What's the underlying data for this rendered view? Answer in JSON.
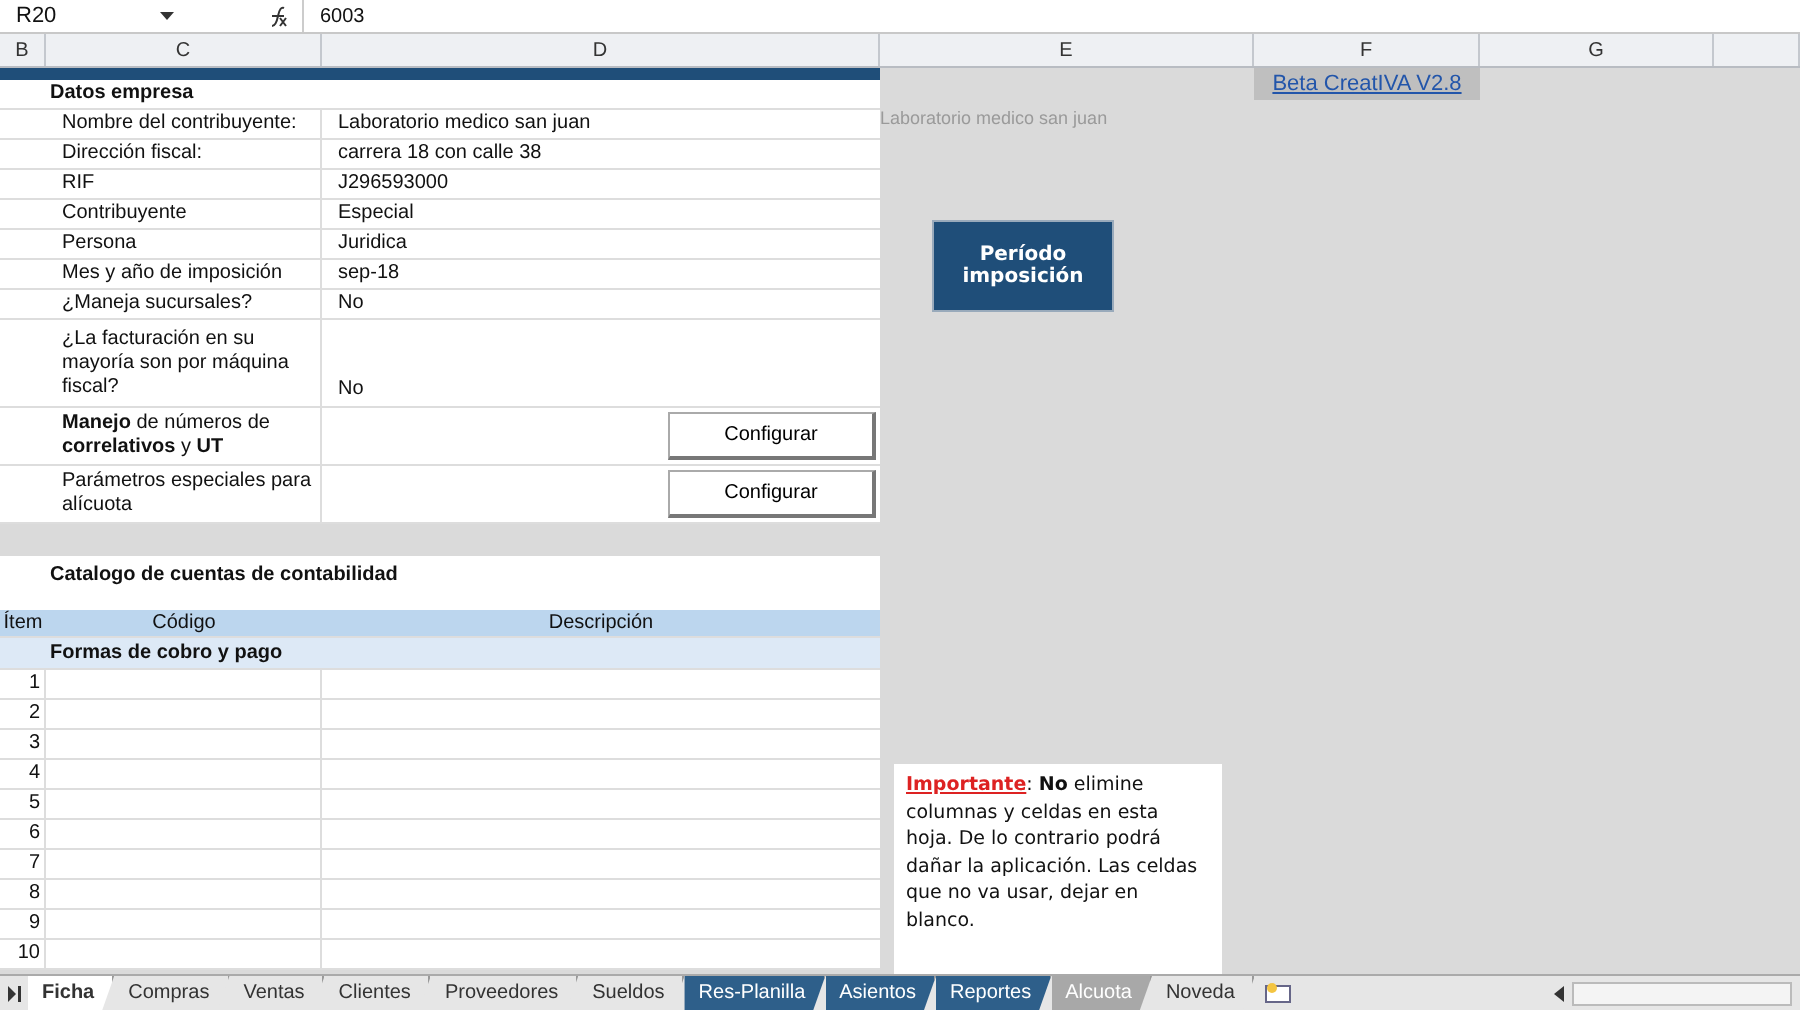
{
  "formula_bar": {
    "cell": "R20",
    "value": "6003"
  },
  "columns": [
    {
      "label": "B"
    },
    {
      "label": "C"
    },
    {
      "label": "D"
    },
    {
      "label": "E"
    },
    {
      "label": "F"
    },
    {
      "label": "G"
    }
  ],
  "company": {
    "title": "Datos empresa",
    "rows": [
      {
        "kind": "text",
        "label": "Nombre del contribuyente:",
        "value": "Laboratorio medico san juan"
      },
      {
        "kind": "text",
        "label": "Dirección fiscal:",
        "value": "carrera 18 con calle 38"
      },
      {
        "kind": "text",
        "label": "RIF",
        "value": "J296593000"
      },
      {
        "kind": "text",
        "label": "Contribuyente",
        "value": "Especial"
      },
      {
        "kind": "text",
        "label": "Persona",
        "value": "Juridica"
      },
      {
        "kind": "text",
        "label": "Mes y año de imposición",
        "value": "sep-18"
      },
      {
        "kind": "text",
        "label": "¿Maneja sucursales?",
        "value": "No"
      },
      {
        "kind": "tall",
        "label": "¿La facturación en su mayoría son por máquina fiscal?",
        "value": "No"
      },
      {
        "kind": "button",
        "label": "**Manejo** de números de **correlativos** y **UT**",
        "value": "Configurar"
      },
      {
        "kind": "button",
        "label": "Parámetros especiales para alícuota",
        "value": "Configurar"
      }
    ]
  },
  "catalog": {
    "title": "Catalogo de cuentas de contabilidad",
    "columns": [
      "Ítem",
      "Código",
      "Descripción"
    ],
    "section": "Formas de cobro y pago",
    "items": [
      "1",
      "2",
      "3",
      "4",
      "5",
      "6",
      "7",
      "8",
      "9",
      "10"
    ]
  },
  "version_link": "Beta CreatIVA V2.8",
  "faded_text": "Laboratorio medico san juan",
  "period_button": "Período imposición",
  "note": {
    "label": "Importante",
    "text": ": **No** elimine columnas y celdas en esta hoja. De lo contrario podrá dañar la aplicación. Las celdas que no va usar, dejar en blanco."
  },
  "sheet_tabs": [
    {
      "label": "Ficha",
      "selected": true
    },
    {
      "label": "Compras",
      "selected": false
    },
    {
      "label": "Ventas",
      "selected": false
    },
    {
      "label": "Clientes",
      "selected": false
    },
    {
      "label": "Proveedores",
      "selected": false
    },
    {
      "label": "Sueldos",
      "selected": false
    },
    {
      "label": "Res-Planilla",
      "selected": false,
      "color": "#2e5f8a"
    },
    {
      "label": "Asientos",
      "selected": false,
      "color": "#2e5f8a"
    },
    {
      "label": "Reportes",
      "selected": false,
      "color": "#2e5f8a"
    },
    {
      "label": "Alcuota",
      "selected": false,
      "color": "#a8a8a8"
    },
    {
      "label": "Noveda",
      "selected": false
    }
  ]
}
